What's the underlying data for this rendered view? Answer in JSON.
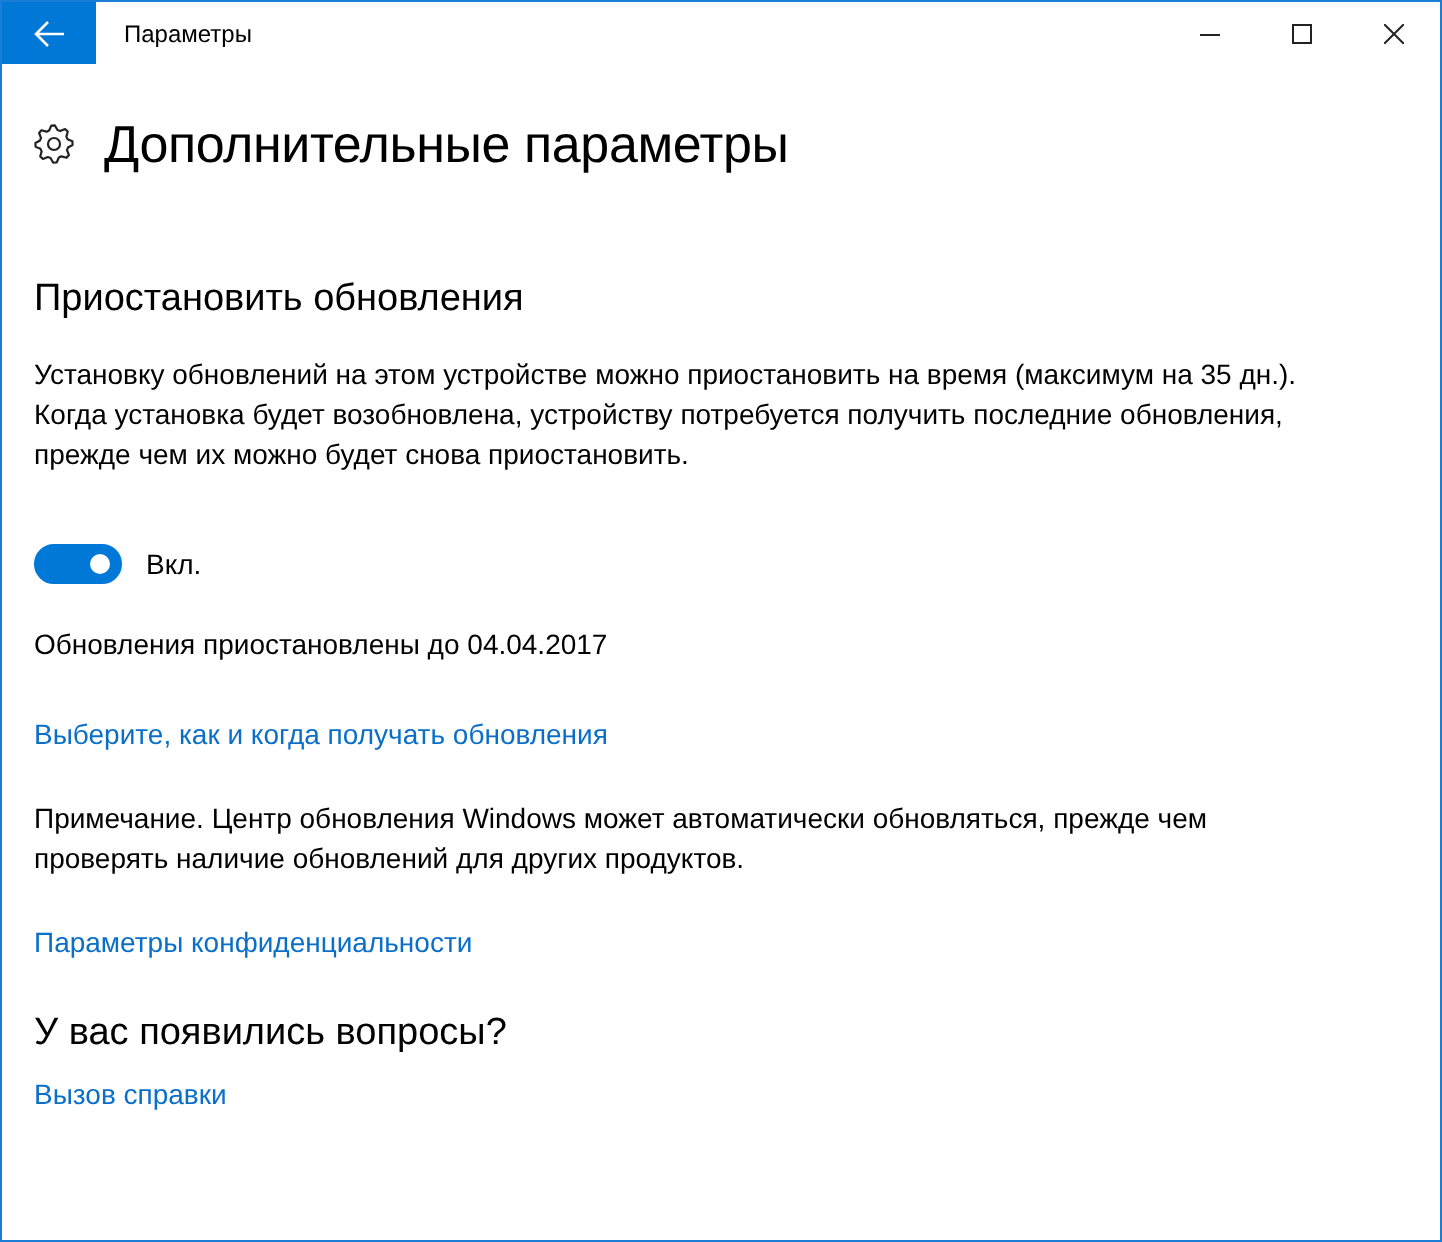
{
  "window": {
    "title": "Параметры"
  },
  "page": {
    "title": "Дополнительные параметры"
  },
  "pause_section": {
    "title": "Приостановить обновления",
    "description": "Установку обновлений на этом устройстве можно приостановить на время (максимум на 35 дн.). Когда установка будет возобновлена, устройству потребуется получить последние обновления, прежде чем их можно будет снова приостановить.",
    "toggle": {
      "on": true,
      "label": "Вкл."
    },
    "status": "Обновления приостановлены до 04.04.2017",
    "link": "Выберите, как и когда получать обновления"
  },
  "note": "Примечание. Центр обновления Windows может автоматически обновляться, прежде чем проверять наличие обновлений для других продуктов.",
  "privacy_link": "Параметры конфиденциальности",
  "help": {
    "title": "У вас появились вопросы?",
    "link": "Вызов справки"
  }
}
